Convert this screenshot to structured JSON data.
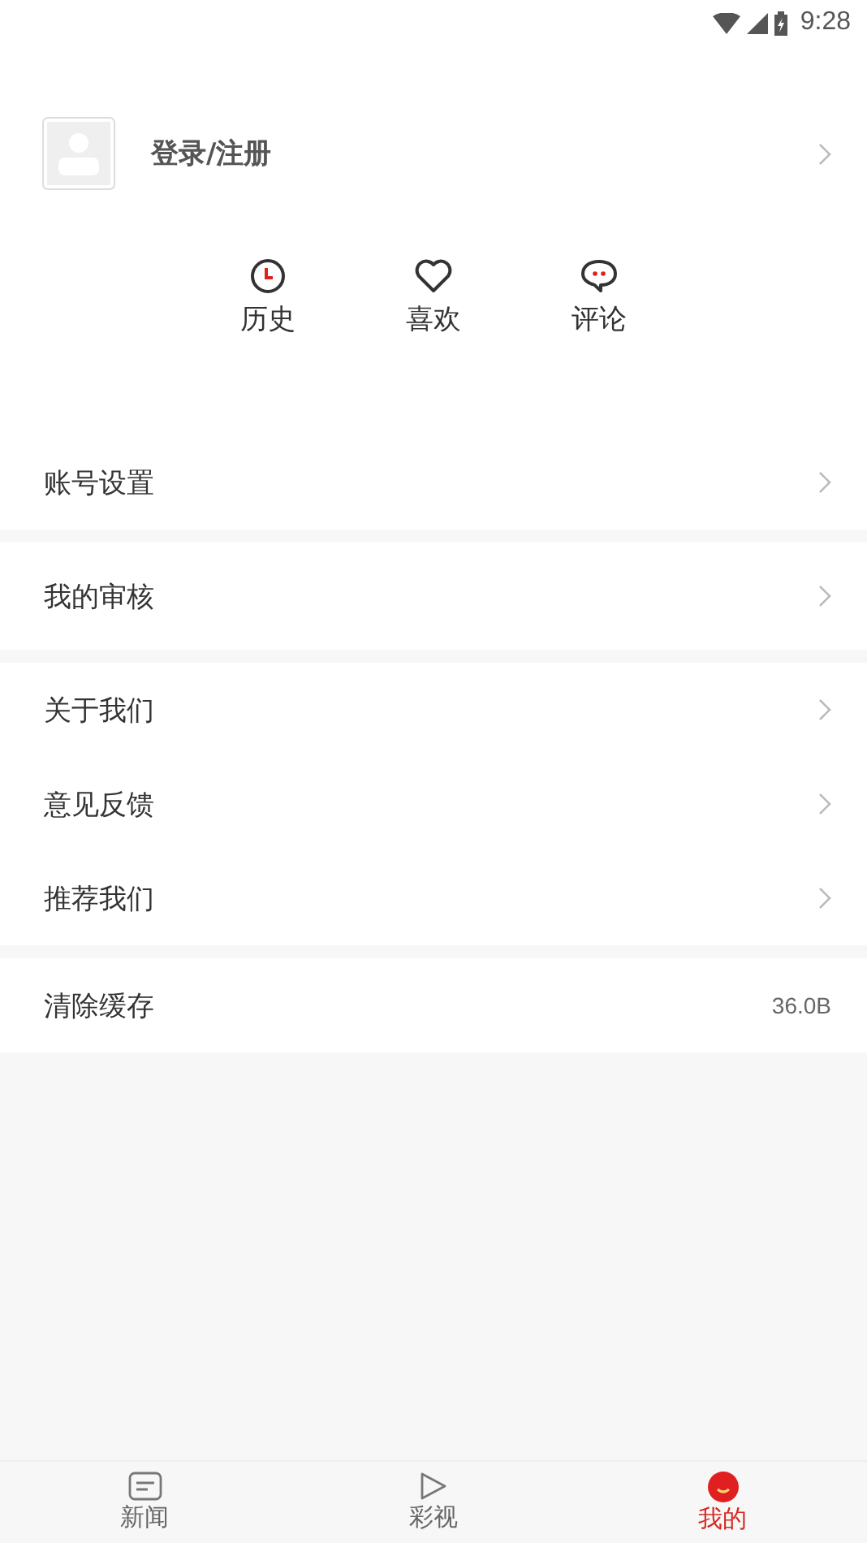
{
  "status_bar": {
    "time": "9:28"
  },
  "profile": {
    "label": "登录/注册"
  },
  "quick_actions": [
    {
      "kind": "clock",
      "label": "历史"
    },
    {
      "kind": "heart",
      "label": "喜欢"
    },
    {
      "kind": "comment",
      "label": "评论"
    }
  ],
  "menu_groups": [
    [
      {
        "kind": "link",
        "label": "账号设置"
      }
    ],
    [
      {
        "kind": "link",
        "label": "我的审核"
      }
    ],
    [
      {
        "kind": "link",
        "label": "关于我们"
      },
      {
        "kind": "link",
        "label": "意见反馈"
      },
      {
        "kind": "link",
        "label": "推荐我们"
      }
    ],
    [
      {
        "kind": "value",
        "label": "清除缓存",
        "value": "36.0B"
      }
    ]
  ],
  "tab_bar": [
    {
      "kind": "news",
      "label": "新闻",
      "selected": false
    },
    {
      "kind": "video",
      "label": "彩视",
      "selected": false
    },
    {
      "kind": "me",
      "label": "我的",
      "selected": true
    }
  ]
}
